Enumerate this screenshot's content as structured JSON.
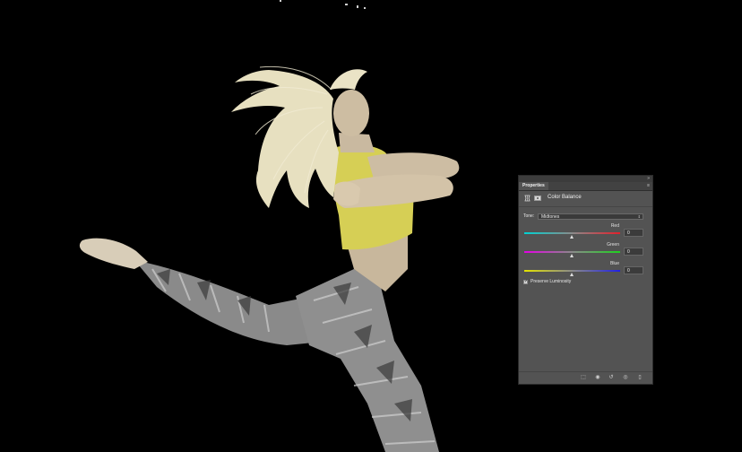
{
  "image": {
    "subject": "photo-dancer-leaping",
    "top_color": "#d9d35a",
    "skin_color": "#c9b9a0",
    "hair_color": "#e9e3c4",
    "legging_color": "#8d8d8d"
  },
  "panel": {
    "tab_label": "Properties",
    "collapse_icon": "double-chevron-icon",
    "menu_icon": "panel-menu-icon",
    "adjustment_title": "Color Balance",
    "tone_label": "Tone:",
    "tone_value": "Midtones",
    "sliders": [
      {
        "label": "Red",
        "value": "0",
        "colors": [
          "#00d2d2",
          "#e2202b"
        ],
        "position": 0.5
      },
      {
        "label": "Green",
        "value": "0",
        "colors": [
          "#e400e4",
          "#1ed21e"
        ],
        "position": 0.5
      },
      {
        "label": "Blue",
        "value": "0",
        "colors": [
          "#e4e400",
          "#2020e4"
        ],
        "position": 0.5
      }
    ],
    "preserve_luminosity_label": "Preserve Luminosity",
    "preserve_luminosity_checked": true,
    "footer_icons": [
      "clip-to-layer-icon",
      "view-previous-icon",
      "reset-icon",
      "visibility-eye-icon",
      "trash-icon"
    ]
  }
}
